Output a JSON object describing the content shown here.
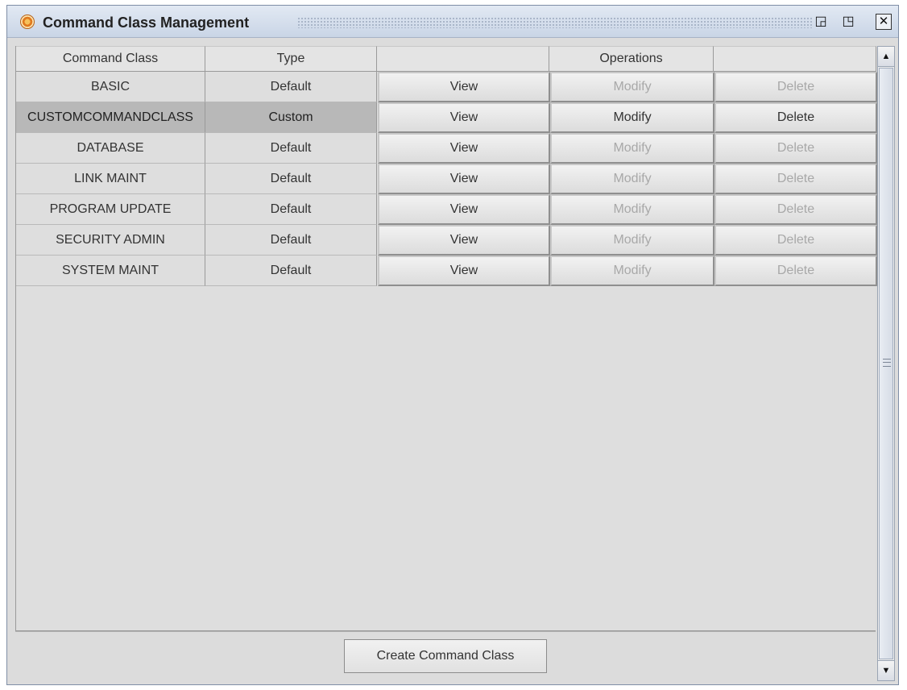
{
  "window": {
    "title": "Command Class Management",
    "controls": {
      "iconify": "◲",
      "maximize": "◳",
      "close": "✕"
    }
  },
  "table": {
    "headers": [
      "Command Class",
      "Type",
      "",
      "Operations",
      ""
    ],
    "rows": [
      {
        "name": "BASIC",
        "type": "Default",
        "view": "View",
        "modify": "Modify",
        "delete": "Delete",
        "modify_enabled": false,
        "delete_enabled": false
      },
      {
        "name": "CUSTOMCOMMANDCLASS",
        "type": "Custom",
        "view": "View",
        "modify": "Modify",
        "delete": "Delete",
        "modify_enabled": true,
        "delete_enabled": true,
        "selected": true
      },
      {
        "name": "DATABASE",
        "type": "Default",
        "view": "View",
        "modify": "Modify",
        "delete": "Delete",
        "modify_enabled": false,
        "delete_enabled": false
      },
      {
        "name": "LINK MAINT",
        "type": "Default",
        "view": "View",
        "modify": "Modify",
        "delete": "Delete",
        "modify_enabled": false,
        "delete_enabled": false
      },
      {
        "name": "PROGRAM UPDATE",
        "type": "Default",
        "view": "View",
        "modify": "Modify",
        "delete": "Delete",
        "modify_enabled": false,
        "delete_enabled": false
      },
      {
        "name": "SECURITY ADMIN",
        "type": "Default",
        "view": "View",
        "modify": "Modify",
        "delete": "Delete",
        "modify_enabled": false,
        "delete_enabled": false
      },
      {
        "name": "SYSTEM MAINT",
        "type": "Default",
        "view": "View",
        "modify": "Modify",
        "delete": "Delete",
        "modify_enabled": false,
        "delete_enabled": false
      }
    ]
  },
  "footer": {
    "create_label": "Create Command Class"
  },
  "scrollbar": {
    "up_arrow": "▲",
    "down_arrow": "▼"
  }
}
